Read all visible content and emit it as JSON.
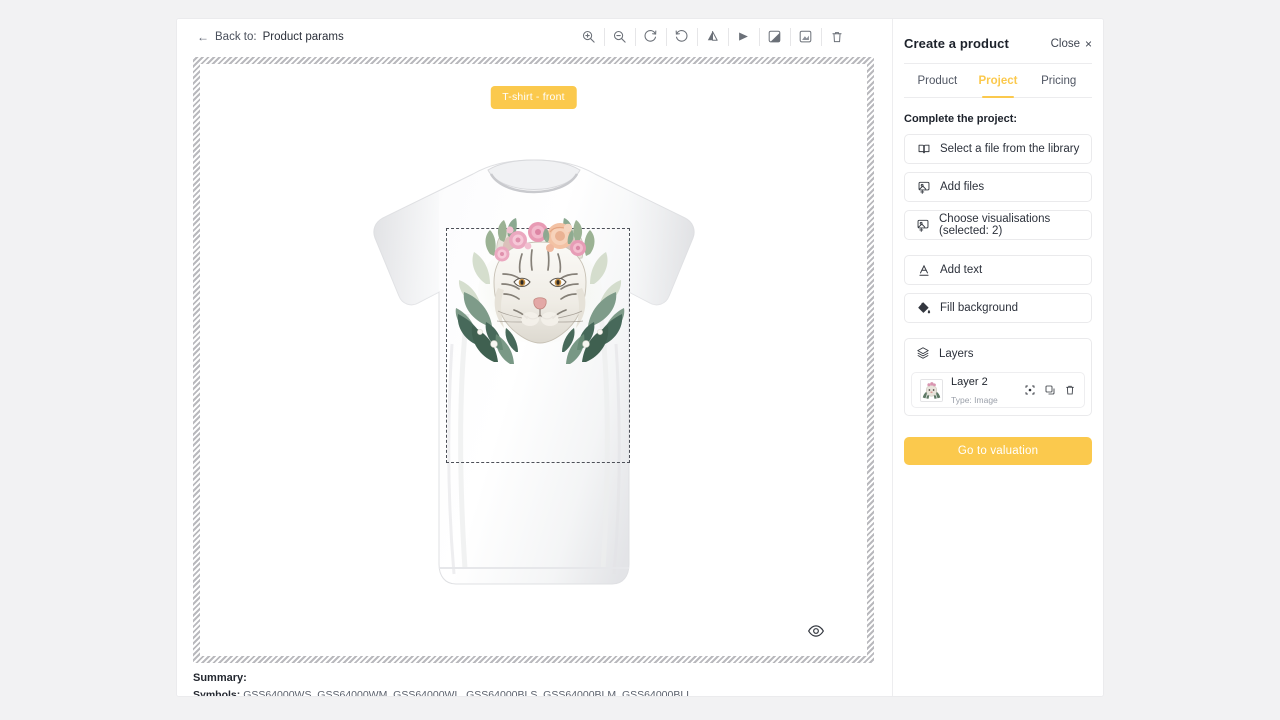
{
  "editor": {
    "back": {
      "arrow": "←",
      "label": "Back to:",
      "value": "Product params"
    },
    "tools": [
      {
        "name": "zoom-in-icon",
        "title": "Zoom in"
      },
      {
        "name": "zoom-out-icon",
        "title": "Zoom out"
      },
      {
        "name": "rotate-right-icon",
        "title": "Rotate right"
      },
      {
        "name": "rotate-left-icon",
        "title": "Rotate left"
      },
      {
        "name": "flip-vertical-icon",
        "title": "Flip vertical"
      },
      {
        "name": "flip-horizontal-icon",
        "title": "Flip horizontal"
      },
      {
        "name": "contrast-icon",
        "title": "Contrast"
      },
      {
        "name": "brightness-icon",
        "title": "Brightness"
      },
      {
        "name": "delete-icon",
        "title": "Delete"
      }
    ],
    "view_badge": "T-shirt - front",
    "preview_icon": "eye-icon"
  },
  "summary": {
    "title": "Summary:",
    "symbols_key": "Symbols:",
    "symbols_value": "GSS64000WS, GSS64000WM, GSS64000WL, GSS64000BLS, GSS64000BLM, GSS64000BLL"
  },
  "panel": {
    "title": "Create a product",
    "close_label": "Close",
    "close_icon": "×",
    "tabs": [
      {
        "label": "Product",
        "active": false
      },
      {
        "label": "Project",
        "active": true
      },
      {
        "label": "Pricing",
        "active": false
      }
    ],
    "section_label": "Complete the project:",
    "actions": [
      {
        "label": "Select a file from the library",
        "icon": "book-icon"
      },
      {
        "label": "Add files",
        "icon": "image-plus-icon"
      },
      {
        "label": "Choose visualisations (selected: 2)",
        "icon": "image-plus-icon"
      },
      {
        "label": "Add text",
        "icon": "text-icon"
      },
      {
        "label": "Fill background",
        "icon": "paint-bucket-icon"
      }
    ],
    "layers": {
      "header": "Layers",
      "items": [
        {
          "name": "Layer 2",
          "type": "Type: Image",
          "actions": [
            "center-icon",
            "duplicate-icon",
            "delete-icon"
          ]
        }
      ]
    },
    "primary_button": "Go to valuation"
  },
  "colors": {
    "accent": "#fbc94d",
    "text": "#1d222b",
    "muted": "#9ba0aa",
    "border": "#eaeaec",
    "page_bg": "#f2f2f3"
  }
}
